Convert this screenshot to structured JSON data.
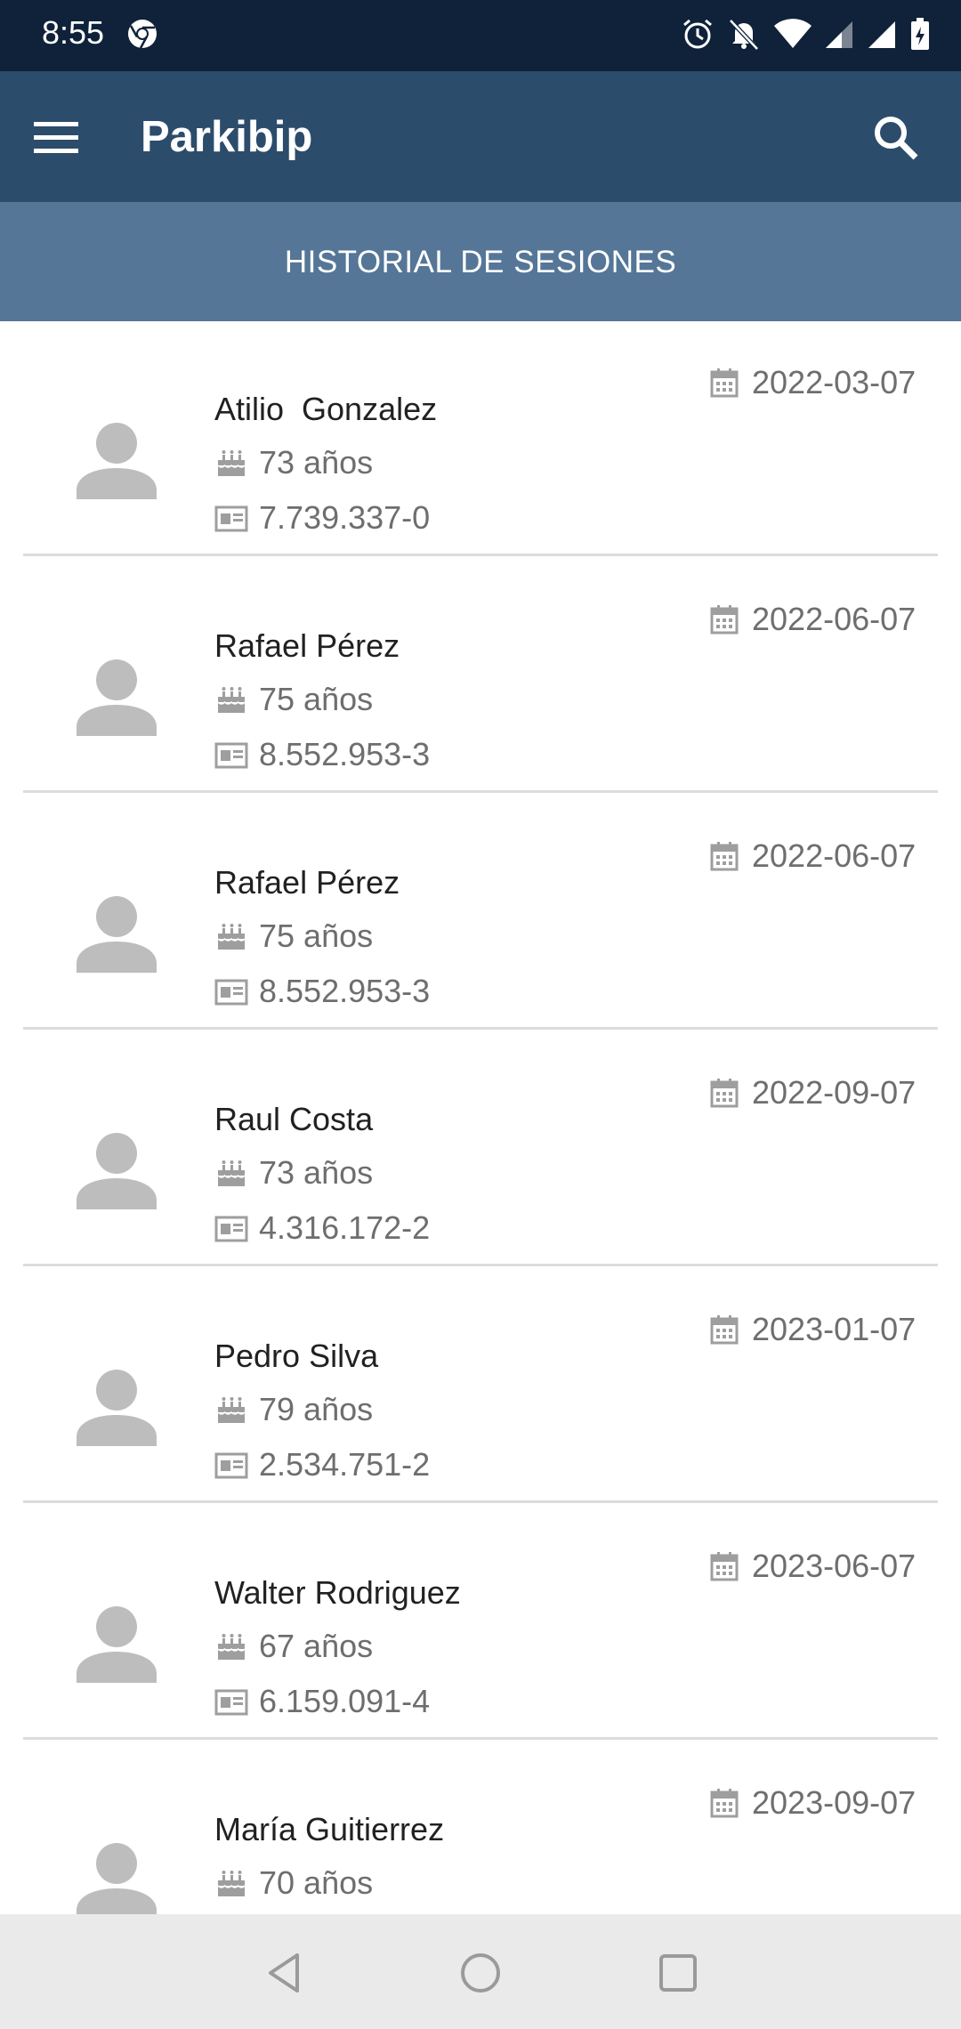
{
  "status_bar": {
    "time": "8:55",
    "icons": [
      "chrome-icon",
      "alarm-icon",
      "notifications-off-icon",
      "wifi-icon",
      "signal-icon",
      "signal-icon",
      "battery-icon"
    ]
  },
  "app_bar": {
    "title": "Parkibip",
    "menu_icon": "menu-icon",
    "search_icon": "search-icon"
  },
  "tab": {
    "label": "HISTORIAL DE SESIONES"
  },
  "colors": {
    "status_bar": "#0f2239",
    "app_bar": "#2c4c6b",
    "tab_bar": "#557697",
    "avatar": "#bdbdbd",
    "secondary_text": "#6e6e6e"
  },
  "sessions": [
    {
      "name": "Atilio  Gonzalez",
      "age": "73 años",
      "id": "7.739.337-0",
      "date": "2022-03-07"
    },
    {
      "name": "Rafael Pérez",
      "age": "75 años",
      "id": "8.552.953-3",
      "date": "2022-06-07"
    },
    {
      "name": "Rafael Pérez",
      "age": "75 años",
      "id": "8.552.953-3",
      "date": "2022-06-07"
    },
    {
      "name": "Raul Costa",
      "age": "73 años",
      "id": "4.316.172-2",
      "date": "2022-09-07"
    },
    {
      "name": "Pedro Silva",
      "age": "79 años",
      "id": "2.534.751-2",
      "date": "2023-01-07"
    },
    {
      "name": "Walter Rodriguez",
      "age": "67 años",
      "id": "6.159.091-4",
      "date": "2023-06-07"
    },
    {
      "name": "María Guitierrez",
      "age": "70 años",
      "id": "",
      "date": "2023-09-07"
    }
  ],
  "nav_bar": {
    "buttons": [
      "back-icon",
      "home-icon",
      "recents-icon"
    ]
  }
}
